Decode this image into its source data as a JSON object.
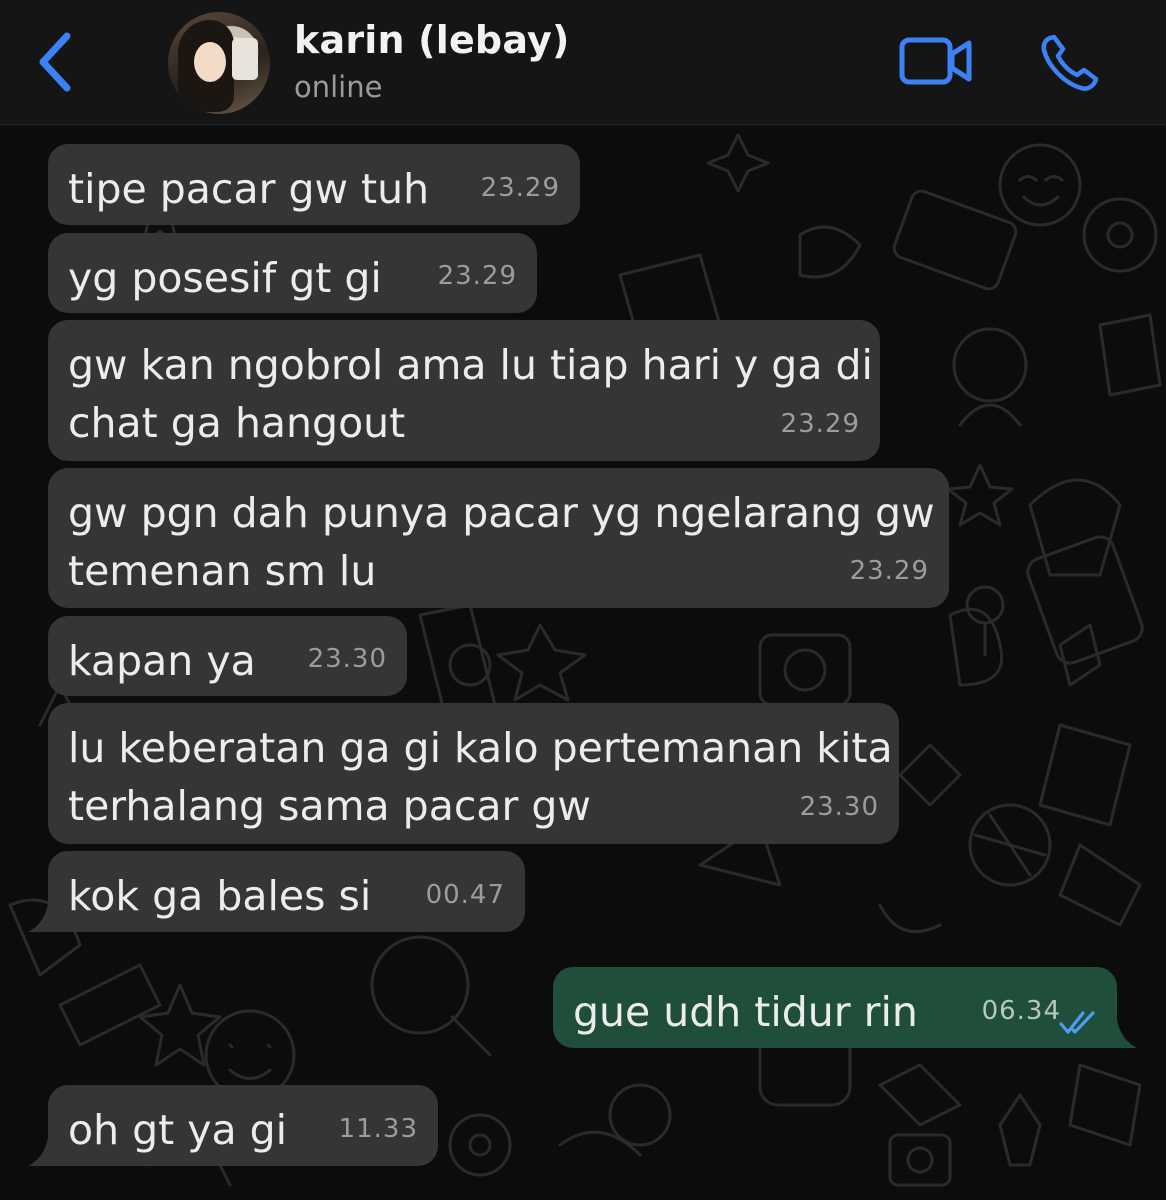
{
  "header": {
    "contact_name": "karin (lebay)",
    "status": "online",
    "icons": {
      "back": "chevron-left-icon",
      "video": "video-camera-icon",
      "voice": "phone-icon"
    },
    "accent_color": "#3b82f6"
  },
  "messages": [
    {
      "direction": "in",
      "text_lines": [
        "tipe pacar gw tuh"
      ],
      "time": "23.29"
    },
    {
      "direction": "in",
      "text_lines": [
        "yg posesif gt gi"
      ],
      "time": "23.29"
    },
    {
      "direction": "in",
      "text_lines": [
        "gw kan ngobrol ama lu tiap hari y ga di",
        "chat ga hangout"
      ],
      "time": "23.29"
    },
    {
      "direction": "in",
      "text_lines": [
        "gw pgn dah punya pacar yg ngelarang gw",
        "temenan sm lu"
      ],
      "time": "23.29"
    },
    {
      "direction": "in",
      "text_lines": [
        "kapan ya"
      ],
      "time": "23.30"
    },
    {
      "direction": "in",
      "text_lines": [
        "lu keberatan ga gi kalo pertemanan kita",
        "terhalang sama pacar gw"
      ],
      "time": "23.30"
    },
    {
      "direction": "in",
      "text_lines": [
        "kok ga bales si"
      ],
      "time": "00.47"
    },
    {
      "direction": "out",
      "text_lines": [
        "gue udh tidur rin"
      ],
      "time": "06.34",
      "read": true
    },
    {
      "direction": "in",
      "text_lines": [
        "oh gt ya gi"
      ],
      "time": "11.33"
    }
  ],
  "colors": {
    "incoming_bubble": "#353535",
    "outgoing_bubble": "#1f4f3b",
    "read_ticks": "#4f9cf0"
  }
}
